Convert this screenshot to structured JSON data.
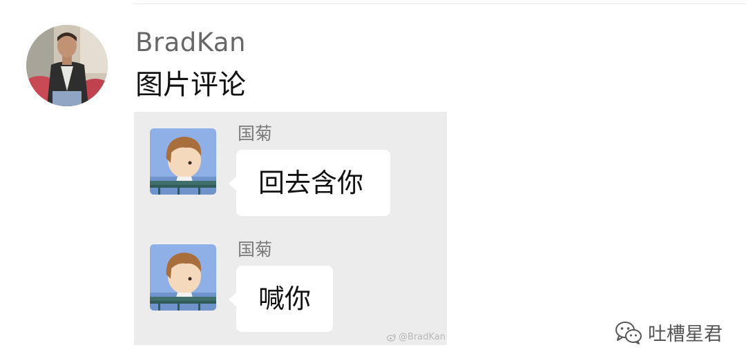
{
  "comment": {
    "username": "BradKan",
    "text": "图片评论",
    "avatar_icon": "user-avatar-photo"
  },
  "screenshot": {
    "background": "#ececec",
    "messages": [
      {
        "sender": "国菊",
        "text": "回去含你",
        "avatar_icon": "cartoon-boy-avatar"
      },
      {
        "sender": "国菊",
        "text": "喊你",
        "avatar_icon": "cartoon-boy-avatar"
      }
    ],
    "watermark": "@BradKan"
  },
  "footer": {
    "watermark_text": "吐槽星君",
    "watermark_icon": "wechat-icon"
  }
}
